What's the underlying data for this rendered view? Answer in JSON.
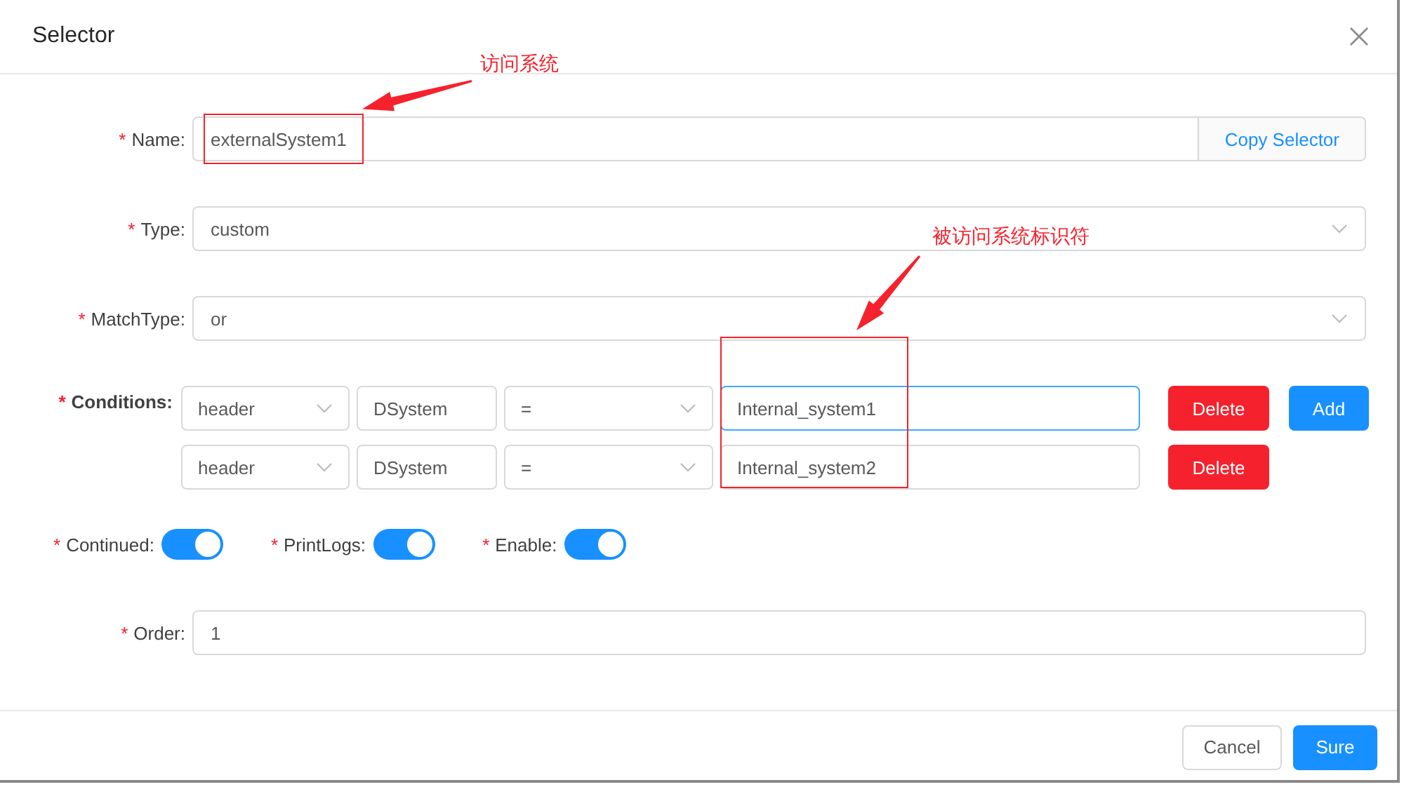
{
  "dialog": {
    "title": "Selector"
  },
  "fields": [
    {
      "kind": "input",
      "required_mark": "*",
      "label": "Name:",
      "value": "externalSystem1",
      "addon": "Copy Selector"
    },
    {
      "kind": "select",
      "required_mark": "*",
      "label": "Type:",
      "value": "custom"
    },
    {
      "kind": "select",
      "required_mark": "*",
      "label": "MatchType:",
      "value": "or"
    }
  ],
  "conditions": {
    "required_mark": "*",
    "label": "Conditions:",
    "add_label": "Add",
    "rows": [
      {
        "field": "header",
        "key": "DSystem",
        "operator": "=",
        "value": "Internal_system1",
        "focused": true,
        "delete_label": "Delete"
      },
      {
        "field": "header",
        "key": "DSystem",
        "operator": "=",
        "value": "Internal_system2",
        "focused": false,
        "delete_label": "Delete"
      }
    ]
  },
  "switches": [
    {
      "required_mark": "*",
      "label": "Continued:",
      "on": true
    },
    {
      "required_mark": "*",
      "label": "PrintLogs:",
      "on": true
    },
    {
      "required_mark": "*",
      "label": "Enable:",
      "on": true
    }
  ],
  "order": {
    "required_mark": "*",
    "label": "Order:",
    "value": "1"
  },
  "footer": [
    {
      "kind": "default",
      "label": "Cancel"
    },
    {
      "kind": "primary",
      "label": "Sure"
    }
  ],
  "annotations": [
    {
      "text": "访问系统"
    },
    {
      "text": "被访问系统标识符"
    }
  ]
}
